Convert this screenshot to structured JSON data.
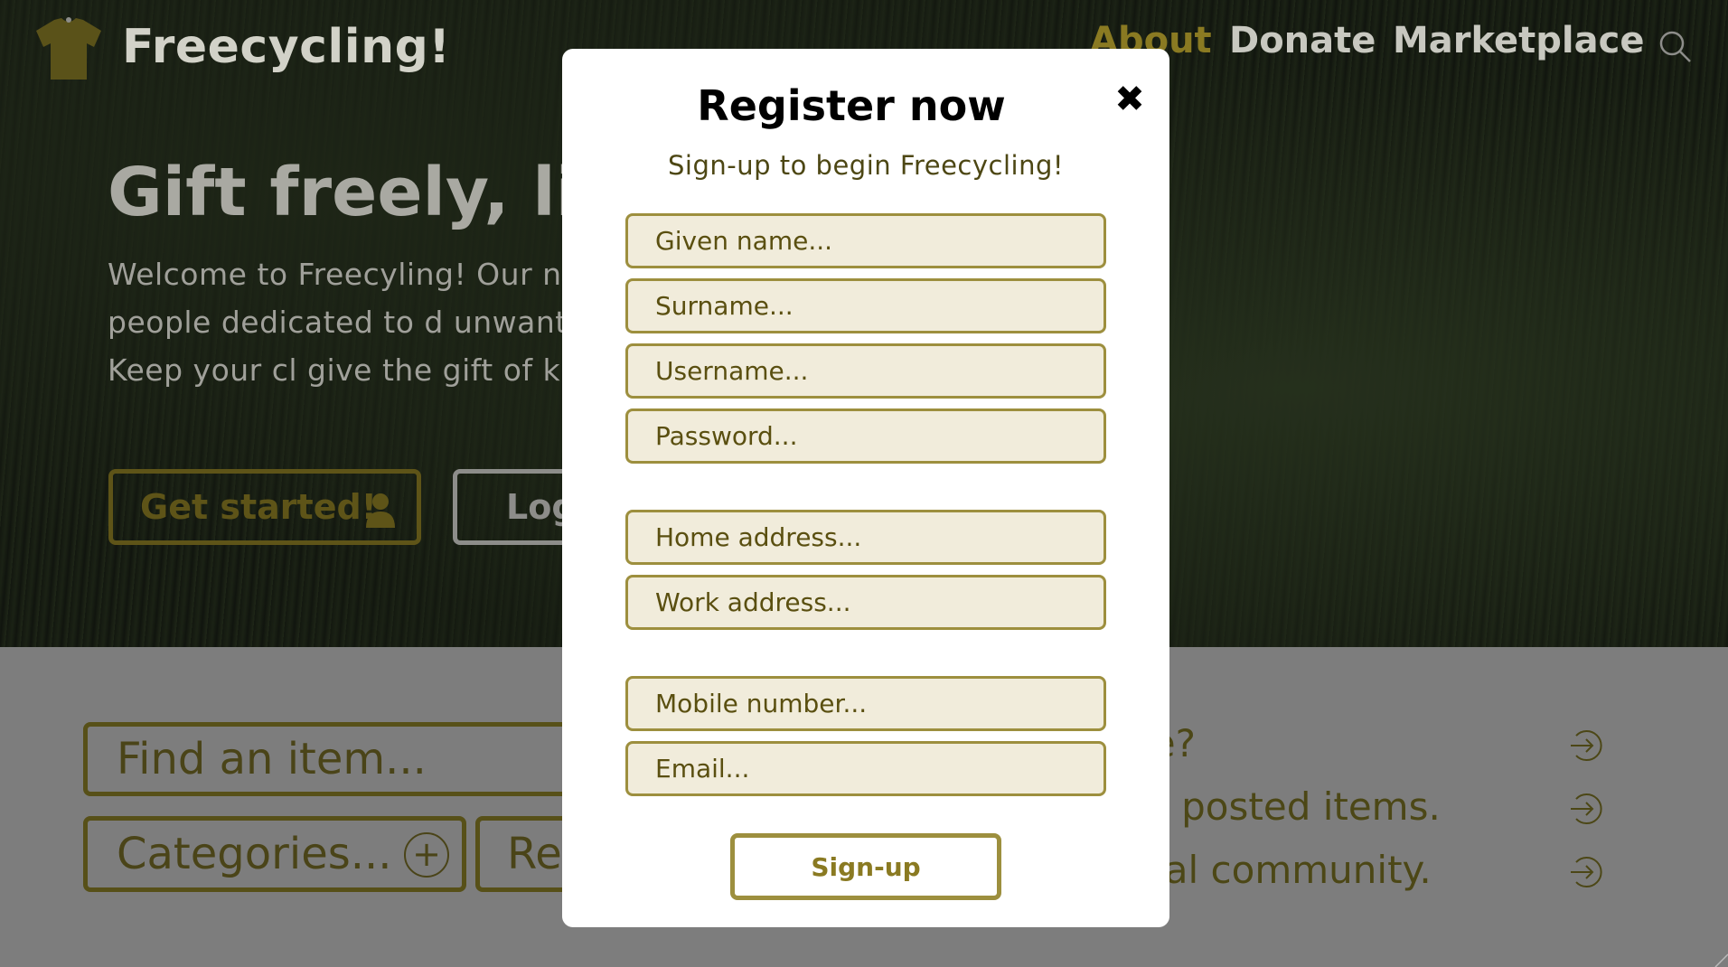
{
  "header": {
    "brand": "Freecycling!",
    "nav": [
      "About",
      "Donate",
      "Marketplace"
    ],
    "icons": {
      "logo": "tshirt-icon",
      "search": "search-icon"
    }
  },
  "hero": {
    "title": "Gift freely, live",
    "text": "Welcome to Freecyling! Our n minded people dedicated to d unwanted items. Keep your cl give the gift of kindness to yo",
    "get_started_label": "Get started!",
    "login_label": "Log"
  },
  "search": {
    "find_placeholder": "Find an item...",
    "categories_label": "Categories...",
    "region_label": "Re"
  },
  "side_links": [
    "cle?",
    "rly posted items.",
    "ocal community."
  ],
  "modal": {
    "title": "Register now",
    "close": "✖",
    "subtitle": "Sign-up to begin Freecycling!",
    "placeholders": {
      "given_name": "Given name...",
      "surname": "Surname...",
      "username": "Username...",
      "password": "Password...",
      "home_address": "Home address...",
      "work_address": "Work address...",
      "mobile": "Mobile number...",
      "email": "Email..."
    },
    "signup_label": "Sign-up"
  },
  "colors": {
    "accent": "#9d8f3e",
    "field_bg": "#f1ecdb",
    "text_olive": "#5a4f10"
  }
}
